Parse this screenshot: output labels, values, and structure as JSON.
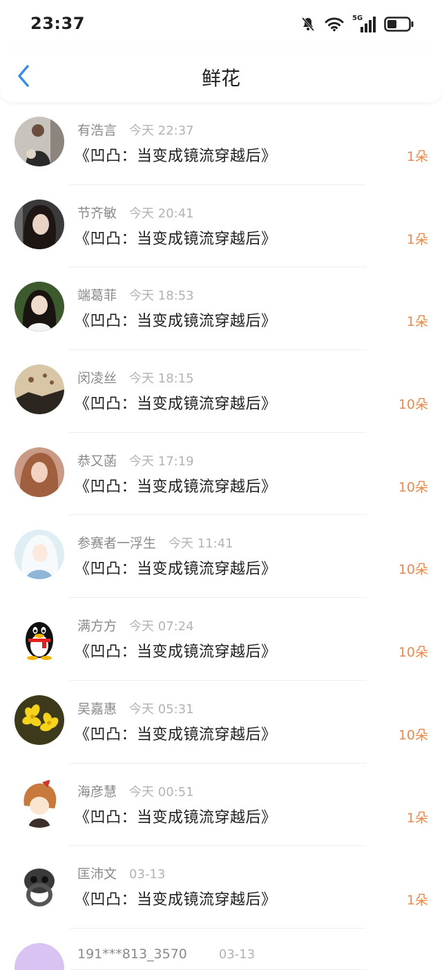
{
  "status_bar": {
    "time": "23:37",
    "network": "5G",
    "icons": [
      "bell-off-icon",
      "wifi-icon",
      "signal-icon",
      "battery-icon"
    ]
  },
  "nav": {
    "title": "鲜花",
    "back_icon": "chevron-left-icon",
    "accent_color": "#3a8ee6"
  },
  "count_color": "#e8894c",
  "items": [
    {
      "name": "有浩言",
      "time": "今天 22:37",
      "book": "《凹凸：当变成镜流穿越后》",
      "count": "1朵"
    },
    {
      "name": "节齐敏",
      "time": "今天 20:41",
      "book": "《凹凸：当变成镜流穿越后》",
      "count": "1朵"
    },
    {
      "name": "端葛菲",
      "time": "今天 18:53",
      "book": "《凹凸：当变成镜流穿越后》",
      "count": "1朵"
    },
    {
      "name": "闵凌丝",
      "time": "今天 18:15",
      "book": "《凹凸：当变成镜流穿越后》",
      "count": "10朵"
    },
    {
      "name": "恭又菡",
      "time": "今天 17:19",
      "book": "《凹凸：当变成镜流穿越后》",
      "count": "10朵"
    },
    {
      "name": "参赛者一浮生",
      "time": "今天 11:41",
      "book": "《凹凸：当变成镜流穿越后》",
      "count": "10朵"
    },
    {
      "name": "满方方",
      "time": "今天 07:24",
      "book": "《凹凸：当变成镜流穿越后》",
      "count": "10朵"
    },
    {
      "name": "吴嘉惠",
      "time": "今天 05:31",
      "book": "《凹凸：当变成镜流穿越后》",
      "count": "10朵"
    },
    {
      "name": "海彦慧",
      "time": "今天 00:51",
      "book": "《凹凸：当变成镜流穿越后》",
      "count": "1朵"
    },
    {
      "name": "匡沛文",
      "time": "03-13",
      "book": "《凹凸：当变成镜流穿越后》",
      "count": "1朵"
    },
    {
      "name": "191***813_3570",
      "time": "03-13",
      "book": "",
      "count": ""
    }
  ]
}
